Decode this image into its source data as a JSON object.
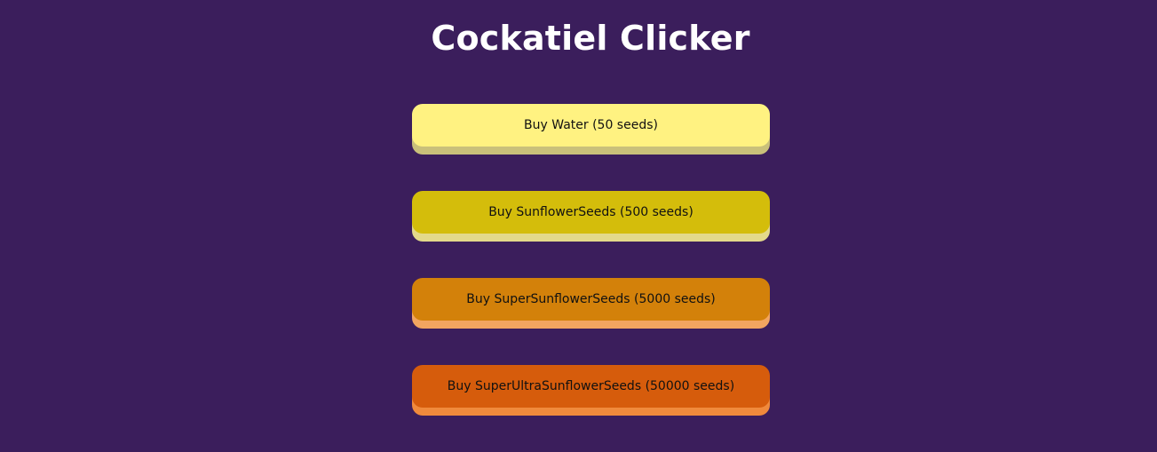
{
  "app": {
    "title": "Cockatiel Clicker"
  },
  "shop": {
    "items": [
      {
        "label": "Buy Water (50 seeds)",
        "color": "#fff281",
        "shadow": "#c9c07a"
      },
      {
        "label": "Buy SunflowerSeeds (500 seeds)",
        "color": "#d4bd0b",
        "shadow": "#e3d98a"
      },
      {
        "label": "Buy SuperSunflowerSeeds (5000 seeds)",
        "color": "#d3810a",
        "shadow": "#f2a560"
      },
      {
        "label": "Buy SuperUltraSunflowerSeeds (50000 seeds)",
        "color": "#d65c0c",
        "shadow": "#f08a3c"
      }
    ]
  },
  "colors": {
    "background": "#3b1e5c",
    "title": "#ffffff",
    "button_text": "#111111"
  }
}
